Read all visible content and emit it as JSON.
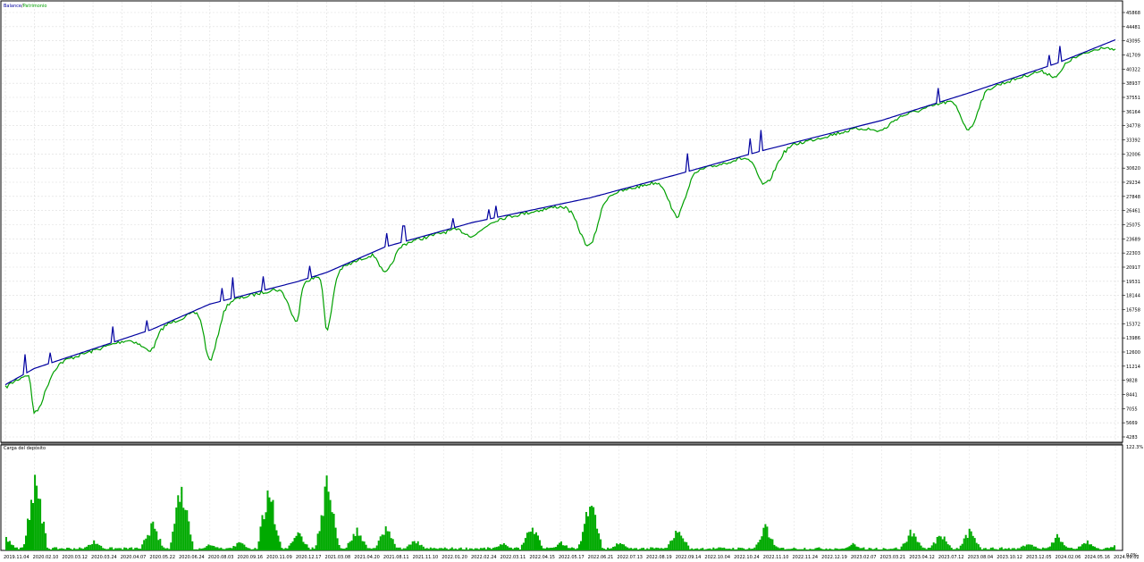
{
  "chart_data": [
    {
      "type": "line",
      "legend": [
        {
          "name": "Balance",
          "color": "#0000a0"
        },
        {
          "name": "Patrimonio",
          "color": "#00a000"
        }
      ],
      "legend_separator": "/",
      "y_ticks": [
        45868,
        44481,
        43095,
        41709,
        40322,
        38937,
        37551,
        36164,
        34778,
        33392,
        32006,
        30620,
        29234,
        27848,
        26461,
        25075,
        23689,
        22303,
        20917,
        19531,
        18144,
        16758,
        15372,
        13986,
        12600,
        11214,
        9828,
        8441,
        7055,
        5669,
        4283
      ],
      "ylim": [
        4283,
        45868
      ],
      "grid": true,
      "series": [
        {
          "name": "Balance",
          "color": "#0000a0",
          "x": [
            "2019.11.04",
            "2020.02.10",
            "2020.05.22",
            "2020.08.03",
            "2020.12.17",
            "2021.03.08",
            "2021.08.11",
            "2022.02.24",
            "2022.06.21",
            "2022.09.14",
            "2022.11.10",
            "2023.03.21",
            "2023.08.04",
            "2024.02.06",
            "2024.09.02"
          ],
          "values": [
            9400,
            11000,
            14800,
            17300,
            19500,
            20400,
            22900,
            25300,
            27700,
            30000,
            32400,
            35300,
            38000,
            40900,
            43200
          ]
        },
        {
          "name": "Patrimonio",
          "color": "#00a000",
          "x": [
            "2019.11.04",
            "2020.02.10",
            "2020.05.22",
            "2020.08.03",
            "2020.12.17",
            "2021.03.08",
            "2021.08.11",
            "2022.02.24",
            "2022.06.21",
            "2022.09.14",
            "2022.11.10",
            "2023.03.21",
            "2023.08.04",
            "2024.02.06",
            "2024.09.02"
          ],
          "values": [
            9300,
            6800,
            13000,
            12000,
            15800,
            14800,
            20500,
            24200,
            23200,
            26100,
            29200,
            34500,
            34600,
            39800,
            42300
          ]
        }
      ]
    },
    {
      "type": "bar",
      "title": "Carga del depósito",
      "y_top_label": "122.3%",
      "y_bottom_label": "0.0%",
      "ylim": [
        0,
        122.3
      ],
      "color": "#00aa00",
      "x_ticks": [
        "2019.11.04",
        "2020.02.10",
        "2020.03.12",
        "2020.03.24",
        "2020.04.07",
        "2020.05.22",
        "2020.06.24",
        "2020.08.03",
        "2020.09.16",
        "2020.11.09",
        "2020.12.17",
        "2021.03.08",
        "2021.04.20",
        "2021.08.11",
        "2021.11.10",
        "2022.01.20",
        "2022.02.24",
        "2022.03.11",
        "2022.04.15",
        "2022.05.17",
        "2022.06.21",
        "2022.07.13",
        "2022.08.19",
        "2022.09.14",
        "2022.10.04",
        "2022.10.24",
        "2022.11.10",
        "2022.11.24",
        "2022.12.19",
        "2023.02.07",
        "2023.03.21",
        "2023.04.12",
        "2023.07.12",
        "2023.08.04",
        "2023.10.12",
        "2023.12.05",
        "2024.02.06",
        "2024.05.16",
        "2024.09.02"
      ],
      "peaks": [
        {
          "x": "2019.11.04",
          "value": 18
        },
        {
          "x": "2020.02.10",
          "value": 120
        },
        {
          "x": "2020.03.24",
          "value": 15
        },
        {
          "x": "2020.05.22",
          "value": 40
        },
        {
          "x": "2020.06.24",
          "value": 105
        },
        {
          "x": "2020.08.03",
          "value": 10
        },
        {
          "x": "2020.09.16",
          "value": 12
        },
        {
          "x": "2020.11.09",
          "value": 100
        },
        {
          "x": "2020.12.17",
          "value": 25
        },
        {
          "x": "2021.03.08",
          "value": 110
        },
        {
          "x": "2021.04.20",
          "value": 30
        },
        {
          "x": "2021.08.11",
          "value": 35
        },
        {
          "x": "2021.11.10",
          "value": 15
        },
        {
          "x": "2022.03.11",
          "value": 10
        },
        {
          "x": "2022.04.15",
          "value": 40
        },
        {
          "x": "2022.05.17",
          "value": 12
        },
        {
          "x": "2022.06.21",
          "value": 80
        },
        {
          "x": "2022.07.13",
          "value": 12
        },
        {
          "x": "2022.09.14",
          "value": 35
        },
        {
          "x": "2022.11.10",
          "value": 35
        },
        {
          "x": "2023.02.07",
          "value": 10
        },
        {
          "x": "2023.04.12",
          "value": 30
        },
        {
          "x": "2023.07.12",
          "value": 25
        },
        {
          "x": "2023.08.04",
          "value": 30
        },
        {
          "x": "2023.12.05",
          "value": 12
        },
        {
          "x": "2024.02.06",
          "value": 22
        },
        {
          "x": "2024.05.16",
          "value": 15
        },
        {
          "x": "2024.09.02",
          "value": 8
        }
      ]
    }
  ]
}
